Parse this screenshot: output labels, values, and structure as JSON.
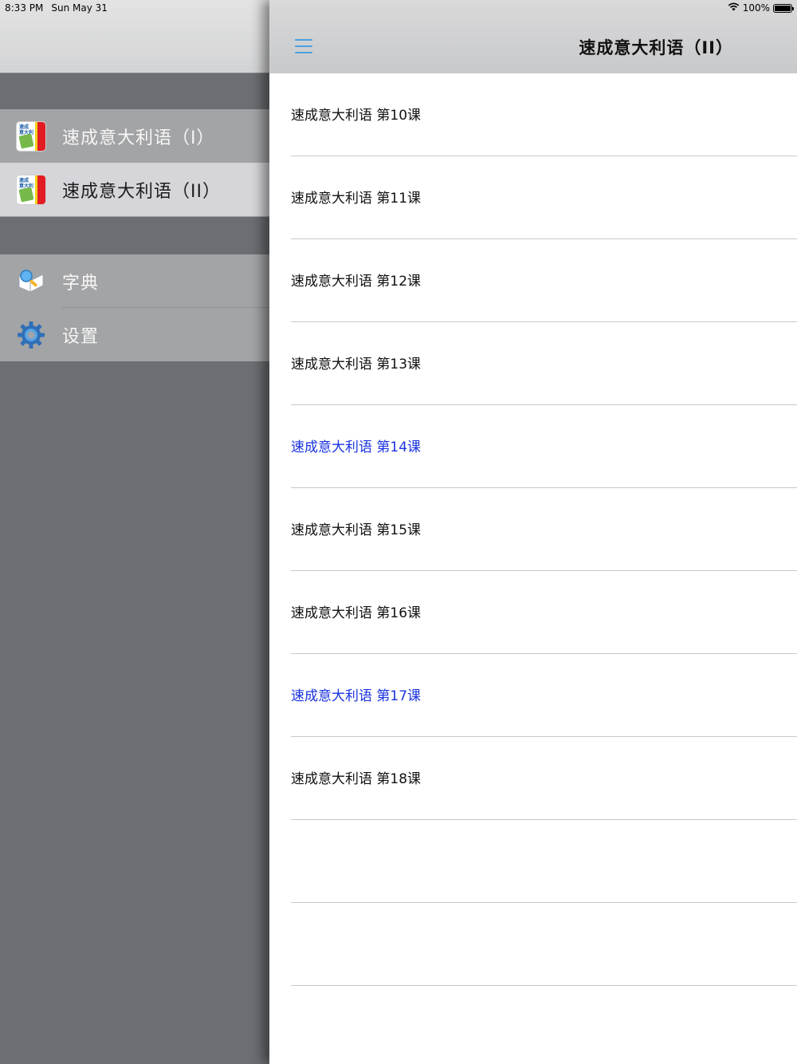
{
  "status_bar": {
    "time": "8:33 PM",
    "date": "Sun May 31",
    "battery_text": "100%",
    "battery_level": 1.0
  },
  "sidebar": {
    "books": [
      {
        "label": "速成意大利语（I）",
        "icon": "book-cover-icon",
        "selected": false
      },
      {
        "label": "速成意大利语（II）",
        "icon": "book-cover-icon",
        "selected": true
      }
    ],
    "tools": [
      {
        "label": "字典",
        "icon": "dictionary-icon"
      },
      {
        "label": "设置",
        "icon": "gear-icon"
      }
    ]
  },
  "navbar": {
    "title": "速成意大利语（II）",
    "menu_icon": "hamburger-menu-icon"
  },
  "lessons": [
    {
      "label": "速成意大利语 第10课",
      "highlighted": false
    },
    {
      "label": "速成意大利语 第11课",
      "highlighted": false
    },
    {
      "label": "速成意大利语 第12课",
      "highlighted": false
    },
    {
      "label": "速成意大利语 第13课",
      "highlighted": false
    },
    {
      "label": "速成意大利语 第14课",
      "highlighted": true
    },
    {
      "label": "速成意大利语 第15课",
      "highlighted": false
    },
    {
      "label": "速成意大利语 第16课",
      "highlighted": false
    },
    {
      "label": "速成意大利语 第17课",
      "highlighted": true
    },
    {
      "label": "速成意大利语 第18课",
      "highlighted": false
    },
    {
      "label": "",
      "highlighted": false
    },
    {
      "label": "",
      "highlighted": false
    }
  ],
  "colors": {
    "accent": "#4aa0de",
    "highlight_text": "#1a33e0",
    "sidebar_bg": "#6b6e72",
    "sidebar_group": "#a3a4a6",
    "selected_row": "#d6d5da"
  }
}
